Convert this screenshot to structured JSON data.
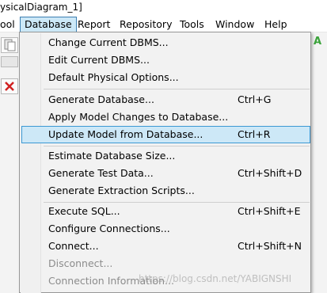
{
  "window": {
    "title": "ysicalDiagram_1]"
  },
  "menubar": {
    "items": [
      {
        "label": "ool"
      },
      {
        "label": "Database"
      },
      {
        "label": "Report"
      },
      {
        "label": "Repository"
      },
      {
        "label": "Tools"
      },
      {
        "label": "Window"
      },
      {
        "label": "Help"
      }
    ]
  },
  "database_menu": {
    "items": [
      {
        "label": "Change Current DBMS...",
        "shortcut": ""
      },
      {
        "label": "Edit Current DBMS...",
        "shortcut": ""
      },
      {
        "label": "Default Physical Options...",
        "shortcut": ""
      },
      {
        "label": "Generate Database...",
        "shortcut": "Ctrl+G"
      },
      {
        "label": "Apply Model Changes to Database...",
        "shortcut": ""
      },
      {
        "label": "Update Model from Database...",
        "shortcut": "Ctrl+R"
      },
      {
        "label": "Estimate Database Size...",
        "shortcut": ""
      },
      {
        "label": "Generate Test Data...",
        "shortcut": "Ctrl+Shift+D"
      },
      {
        "label": "Generate Extraction Scripts...",
        "shortcut": ""
      },
      {
        "label": "Execute SQL...",
        "shortcut": "Ctrl+Shift+E"
      },
      {
        "label": "Configure Connections...",
        "shortcut": ""
      },
      {
        "label": "Connect...",
        "shortcut": "Ctrl+Shift+N"
      },
      {
        "label": "Disconnect...",
        "shortcut": ""
      },
      {
        "label": "Connection Information...",
        "shortcut": ""
      }
    ]
  },
  "watermark": "https://blog.csdn.net/YABIGNSHI",
  "colors": {
    "highlight": "#cde8f7",
    "highlight_border": "#3c98d3",
    "disabled_text": "#8c8c8c"
  }
}
